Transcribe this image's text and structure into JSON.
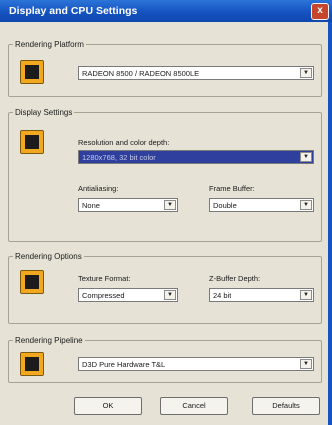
{
  "window": {
    "title": "Display and CPU Settings",
    "close_glyph": "x"
  },
  "rendering_platform": {
    "legend": "Rendering Platform",
    "icon": "gpu-card-icon",
    "value": "RADEON 8500 / RADEON 8500LE"
  },
  "display_settings": {
    "legend": "Display Settings",
    "icon": "monitor-icon",
    "resolution_label": "Resolution and color depth:",
    "resolution_value": "1280x768, 32 bit color",
    "antialiasing_label": "Antialiasing:",
    "antialiasing_value": "None",
    "framebuffer_label": "Frame Buffer:",
    "framebuffer_value": "Double"
  },
  "rendering_options": {
    "legend": "Rendering Options",
    "icon": "texture-icon",
    "texture_label": "Texture Format:",
    "texture_value": "Compressed",
    "zbuffer_label": "Z-Buffer Depth:",
    "zbuffer_value": "24 bit"
  },
  "rendering_pipeline": {
    "legend": "Rendering Pipeline",
    "icon": "pipeline-icon",
    "value": "D3D Pure Hardware T&L"
  },
  "buttons": {
    "ok": "OK",
    "cancel": "Cancel",
    "defaults": "Defaults"
  },
  "colors": {
    "titlebar": "#1553c0",
    "icon_orange": "#f1a81e",
    "selection": "#2e3f9e"
  }
}
